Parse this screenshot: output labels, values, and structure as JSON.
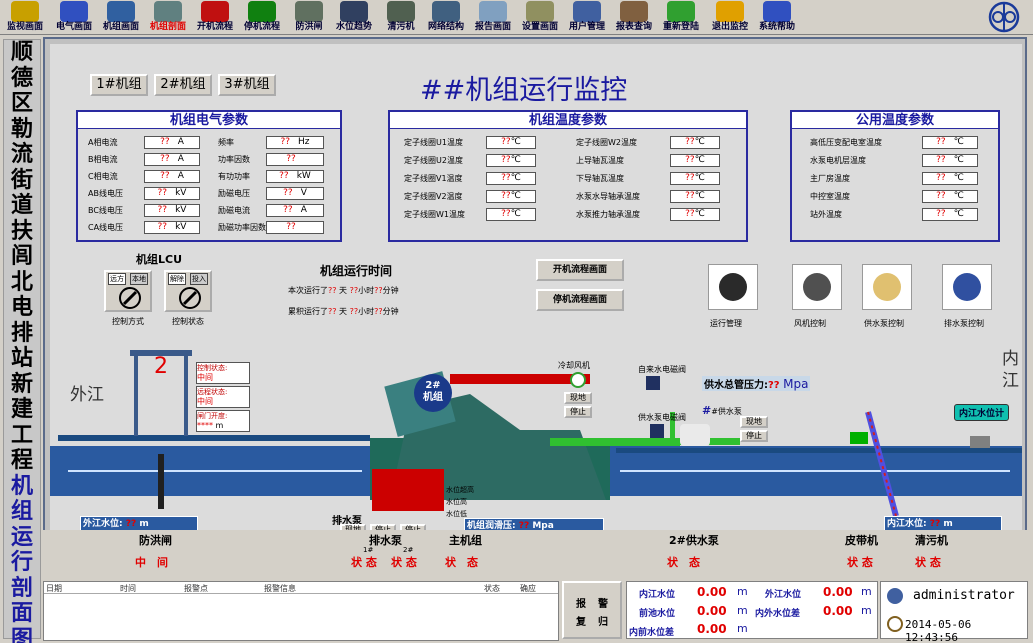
{
  "toolbar": {
    "items": [
      {
        "label": "监视画面",
        "icon": "monitor-icon",
        "color": "#c8a000"
      },
      {
        "label": "电气画面",
        "icon": "electric-icon",
        "color": "#3050c0"
      },
      {
        "label": "机组画面",
        "icon": "unit-icon",
        "color": "#3060a0"
      },
      {
        "label": "机组剖面",
        "icon": "section-icon",
        "color": "#608080"
      },
      {
        "label": "开机流程",
        "icon": "start-icon",
        "color": "#c01010"
      },
      {
        "label": "停机流程",
        "icon": "stop-icon",
        "color": "#108010"
      },
      {
        "label": "防洪闸",
        "icon": "gate-icon",
        "color": "#607060"
      },
      {
        "label": "水位趋势",
        "icon": "trend-icon",
        "color": "#304060"
      },
      {
        "label": "清污机",
        "icon": "cleaner-icon",
        "color": "#506050"
      },
      {
        "label": "网络结构",
        "icon": "network-icon",
        "color": "#406080"
      },
      {
        "label": "报告画面",
        "icon": "report-icon",
        "color": "#80a0c0"
      },
      {
        "label": "设置画面",
        "icon": "settings-icon",
        "color": "#909060"
      },
      {
        "label": "用户管理",
        "icon": "users-icon",
        "color": "#4060a0"
      },
      {
        "label": "报表查询",
        "icon": "query-icon",
        "color": "#806040"
      },
      {
        "label": "重新登陆",
        "icon": "relogin-icon",
        "color": "#30a030"
      },
      {
        "label": "退出监控",
        "icon": "exit-icon",
        "color": "#e0a000"
      },
      {
        "label": "系统帮助",
        "icon": "help-icon",
        "color": "#3050c0"
      }
    ],
    "active_index": 3
  },
  "side_title": {
    "chars": [
      "顺",
      "德",
      "区",
      "勒",
      "流",
      "街",
      "道",
      "扶",
      "闾",
      "北",
      "电",
      "排",
      "站",
      "新",
      "建",
      "工",
      "程",
      "机",
      "组",
      "运",
      "行",
      "剖",
      "面",
      "图"
    ]
  },
  "units": {
    "btn1": "1#机组",
    "btn2": "2#机组",
    "btn3": "3#机组"
  },
  "page_title": "##机组运行监控",
  "elec": {
    "title": "机组电气参数",
    "rows": [
      {
        "l1": "A相电流",
        "v1": "??",
        "u1": "A",
        "l2": "频率",
        "v2": "??",
        "u2": "Hz"
      },
      {
        "l1": "B相电流",
        "v1": "??",
        "u1": "A",
        "l2": "功率因数",
        "v2": "??",
        "u2": ""
      },
      {
        "l1": "C相电流",
        "v1": "??",
        "u1": "A",
        "l2": "有功功率",
        "v2": "??",
        "u2": "kW"
      },
      {
        "l1": "AB线电压",
        "v1": "??",
        "u1": "kV",
        "l2": "励磁电压",
        "v2": "??",
        "u2": "V"
      },
      {
        "l1": "BC线电压",
        "v1": "??",
        "u1": "kV",
        "l2": "励磁电流",
        "v2": "??",
        "u2": "A"
      },
      {
        "l1": "CA线电压",
        "v1": "??",
        "u1": "kV",
        "l2": "励磁功率因数",
        "v2": "??",
        "u2": ""
      }
    ]
  },
  "temp": {
    "title": "机组温度参数",
    "left": [
      {
        "label": "定子线圈U1温度",
        "value": "??",
        "unit": "℃"
      },
      {
        "label": "定子线圈U2温度",
        "value": "??",
        "unit": "℃"
      },
      {
        "label": "定子线圈V1温度",
        "value": "??",
        "unit": "℃"
      },
      {
        "label": "定子线圈V2温度",
        "value": "??",
        "unit": "℃"
      },
      {
        "label": "定子线圈W1温度",
        "value": "??",
        "unit": "℃"
      }
    ],
    "right": [
      {
        "label": "定子线圈W2温度",
        "value": "??",
        "unit": "℃"
      },
      {
        "label": "上导轴瓦温度",
        "value": "??",
        "unit": "℃"
      },
      {
        "label": "下导轴瓦温度",
        "value": "??",
        "unit": "℃"
      },
      {
        "label": "水泵水导轴承温度",
        "value": "??",
        "unit": "℃"
      },
      {
        "label": "水泵推力轴承温度",
        "value": "??",
        "unit": "℃"
      }
    ]
  },
  "pub": {
    "title": "公用温度参数",
    "rows": [
      {
        "label": "高低压变配电室温度",
        "value": "??",
        "unit": "℃"
      },
      {
        "label": "水泵电机层温度",
        "value": "??",
        "unit": "℃"
      },
      {
        "label": "主厂房温度",
        "value": "??",
        "unit": "℃"
      },
      {
        "label": "中控室温度",
        "value": "??",
        "unit": "℃"
      },
      {
        "label": "站外温度",
        "value": "??",
        "unit": "℃"
      }
    ]
  },
  "lcu": {
    "title": "机组LCU",
    "box1_a": "远方",
    "box1_b": "本地",
    "box2_a": "解除",
    "box2_b": "投入",
    "label1": "控制方式",
    "label2": "控制状态"
  },
  "runtime": {
    "title": "机组运行时间",
    "row1_prefix": "本次运行了",
    "row2_prefix": "累积运行了",
    "d": "??",
    "d_unit": "天",
    "h": "??",
    "h_unit": "小时",
    "m": "??",
    "m_unit": "分钟"
  },
  "flowbtns": {
    "start": "开机流程画面",
    "stop": "停机流程画面"
  },
  "devices": [
    {
      "label": "运行管理",
      "icon": "fan-icon"
    },
    {
      "label": "风机控制",
      "icon": "blower-icon"
    },
    {
      "label": "供水泵控制",
      "icon": "supply-pump-icon"
    },
    {
      "label": "排水泵控制",
      "icon": "drain-pump-icon"
    }
  ],
  "scene": {
    "outer_river": "外江",
    "inner_river": "内江",
    "gate_no": "2",
    "gate_status_label": "控制状态:",
    "gate_status_val": "中间",
    "gate_pos_label": "远程状态:",
    "gate_pos_val": "中间",
    "gate_open_label": "闸门开度:",
    "gate_open_val": "****",
    "gate_open_unit": "m",
    "unit_label": "2#\n机组",
    "fan_label": "冷却风机",
    "fan_btn_a": "现地",
    "fan_btn_b": "停止",
    "valve_label": "自来水电磁阀",
    "supply_pressure_label": "供水总管压力:",
    "supply_pressure_val": "??",
    "supply_pressure_unit": "Mpa",
    "supply_valve_label": "供水泵电磁阀",
    "supply_pump_label": "#供水泵",
    "supply_btn_a": "现地",
    "supply_btn_b": "停止",
    "inner_level_btn": "内江水位计",
    "drain_label": "排水泵",
    "drain_btn_a": "现地",
    "drain_btn_b": "停止",
    "drain_btn_c": "停止",
    "drain_level1": "水位超高",
    "drain_level2": "水位高",
    "drain_level3": "水位低",
    "outer_level_label": "外江水位:",
    "outer_level_val": "??",
    "outer_level_unit": "m",
    "inner_level_label": "内江水位:",
    "inner_level_val": "??",
    "inner_level_unit": "m",
    "seal_label": "机组润滑压:",
    "seal_val": "??",
    "seal_unit": "Mpa"
  },
  "status_bar": {
    "flood": "防洪闸",
    "flood_val": "中　间",
    "drain": "排水泵",
    "drain_n1": "1#",
    "drain_n2": "2#",
    "drain_v1": "状 态",
    "drain_v2": "状 态",
    "main": "主机组",
    "main_v": "状　态",
    "supply": "2#供水泵",
    "supply_v": "状　态",
    "belt": "皮带机",
    "belt_v": "状 态",
    "clean": "清污机",
    "clean_v": "状 态"
  },
  "alarm": {
    "cols": [
      "日期",
      "时间",
      "报警点",
      "报警信息",
      "状态",
      "确应"
    ]
  },
  "report": {
    "a": "报",
    "b": "警",
    "c": "复",
    "d": "归"
  },
  "levels": {
    "inner": "内江水位",
    "inner_v": "0.00",
    "inner_u": "m",
    "front": "前池水位",
    "front_v": "0.00",
    "front_u": "m",
    "innerdiff": "内前水位差",
    "innerdiff_v": "0.00",
    "innerdiff_u": "m",
    "outer": "外江水位",
    "outer_v": "0.00",
    "outer_u": "m",
    "outerdiff": "内外水位差",
    "outerdiff_v": "0.00",
    "outerdiff_u": "m"
  },
  "user": {
    "name": "administrator",
    "datetime": "2014-05-06 12:43:56"
  }
}
